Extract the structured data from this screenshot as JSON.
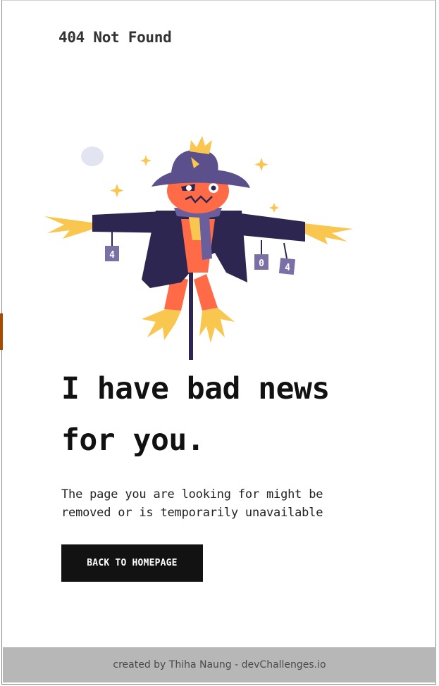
{
  "header": {
    "title": "404 Not Found"
  },
  "illustration": {
    "name": "scarecrow",
    "sign_digits": [
      "4",
      "0",
      "4"
    ],
    "colors": {
      "hat": "#5b4f8c",
      "face": "#ff6a47",
      "coat": "#2c2650",
      "straw": "#f9c74f",
      "scarf": "#6a5e9c"
    }
  },
  "main": {
    "headline": "I have bad news for you.",
    "description": "The page you are looking for might be removed or is temporarily unavailable",
    "button_label": "BACK TO HOMEPAGE"
  },
  "footer": {
    "prefix": "created by ",
    "author": "Thiha Naung",
    "separator": " - ",
    "site": "devChallenges.io"
  }
}
